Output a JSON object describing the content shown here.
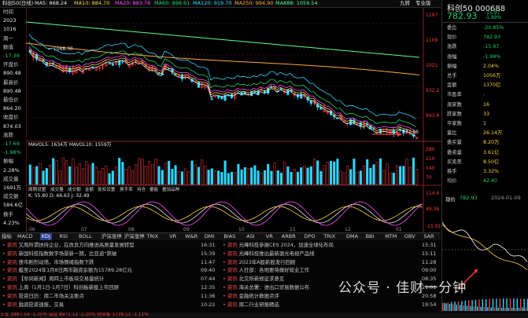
{
  "topbar": {
    "title": "科创50(日线)",
    "ma5": "MA5: 868.24",
    "ma10": "MA10: 884.70",
    "ma20": "MA20: 883.76",
    "ma60": "MA60: 898.61",
    "ma120": "MA120: 919.70",
    "ma250": "MA250: 994.90",
    "ma888": "MA888: 1059.54",
    "right_label": "九转",
    "right_label2": "专业版"
  },
  "left_info": {
    "labels": [
      "时间",
      "2023",
      "1016",
      "周一",
      "数值",
      "-17.36",
      "开盘价",
      "890.48",
      "最高价",
      "890.48",
      "最低价",
      "864.20",
      "收盘价",
      "874.03",
      "涨跌",
      "-17.69",
      "-1.98%",
      "振幅",
      "2.28%",
      "成交量",
      "1691万",
      "成交额",
      "584.6亿",
      "换手",
      "4.23%"
    ]
  },
  "chart": {
    "price_labels": [
      "1197",
      "1109",
      "1021",
      "932.2",
      "843.8",
      "777.56"
    ],
    "high_label": "1068.30",
    "low_label": "777.56",
    "vol_header": "MAVOL5: 1634万  MAVOL10: 1559万",
    "vol_labels": [
      "280",
      "210",
      "140",
      "70"
    ],
    "kdj_header": "K: 55.80  D: 66.63  J: 32.49",
    "kdj_labels": [
      "114.6",
      "49.36",
      "-15.91"
    ],
    "toolbar_items": [
      "周期设置",
      "成交量",
      "成交额",
      "金额",
      "复权设置",
      "换手率",
      "持仓",
      "量能",
      "叠加品种"
    ],
    "x_labels": [
      "06",
      "07",
      "08",
      "09",
      "10",
      "11",
      "12",
      "01"
    ]
  },
  "tabs": [
    "指标",
    "MACD",
    "KDJ",
    "RSI",
    "BOLL",
    "沪深涨停",
    "沪深涨停",
    "TRIX",
    "VR",
    "W&R",
    "DMI",
    "BIAS",
    "ASI",
    "VR",
    "ARBR",
    "DPO",
    "TRIX",
    "DMA",
    "BBI",
    "MTM",
    "OBV",
    "SAR",
    "EXPMA",
    "沪股通",
    "沪深上",
    "更多"
  ],
  "news": {
    "left": [
      {
        "src": "资讯",
        "title": "又周所谓扶持企业，在改良方向推进高质量发展转型",
        "time": "16:31"
      },
      {
        "src": "资讯",
        "title": "新国科技指数数字场景新一期，比亚迪“跌破",
        "time": "15:39"
      },
      {
        "src": "资讯",
        "title": "债市剧烈动荡，市场情绪指数下跌",
        "time": "11:47"
      },
      {
        "src": "资讯",
        "title": "截至2024年1月8日两市融资余额为15789.28亿元",
        "time": "09:40"
      },
      {
        "src": "资讯",
        "title": "【早间新闻】周四上市板块交易量统计",
        "time": "07:44"
      },
      {
        "src": "资讯",
        "title": "上周（1月1日-1月7日）科创板新股上市回顾",
        "time": "12:35"
      },
      {
        "src": "资讯",
        "title": "投资日历：周二市场关注要点",
        "time": "11:36"
      },
      {
        "src": "资讯",
        "title": "融资投资速报，交易",
        "time": "10:22"
      }
    ],
    "right": [
      {
        "src": "资讯",
        "title": "光峰科技参展CES 2024，加速全球化布局",
        "time": "15:31"
      },
      {
        "src": "资讯",
        "title": "光峰科技推出最新激光电视产品线",
        "time": "15:11"
      },
      {
        "src": "资讯",
        "title": "2023年A股新股发行回顾",
        "time": "11:28"
      },
      {
        "src": "资讯",
        "title": "人社部：各地要将做好就业工作",
        "time": "09:00"
      },
      {
        "src": "资讯",
        "title": "北交所新规征求意见",
        "time": "08:35"
      },
      {
        "src": "资讯",
        "title": "海关总署：进出口贸易数据公布",
        "time": "21:01"
      },
      {
        "src": "资讯",
        "title": "金融统计数据点评",
        "time": "20:58"
      },
      {
        "src": "资讯",
        "title": "周二行业研报精选",
        "time": "19:54"
      }
    ]
  },
  "status_bar": "上证 2887.54 -1.35% 深证 8971.12 -1.20% 创业板 1738.11 -1.11%",
  "right_panel": {
    "title": "科创50",
    "code": "000688",
    "price": "782.93",
    "change": "-15.97",
    "pct": "-1.99%",
    "rows": [
      {
        "k": "委比",
        "v": "-20.85%"
      },
      {
        "k": "现价",
        "v": "782.93"
      },
      {
        "k": "涨跌",
        "v": "-15.97"
      },
      {
        "k": "涨幅",
        "v": "-1.99%"
      },
      {
        "k": "振幅",
        "v": "2.04%"
      },
      {
        "k": "总手",
        "v": "1056万"
      },
      {
        "k": "金额",
        "v": "1370亿"
      },
      {
        "k": "市盈率",
        "v": "-"
      },
      {
        "k": "涨家数",
        "v": "16"
      },
      {
        "k": "跌家数",
        "v": "33"
      },
      {
        "k": "平家数",
        "v": "1"
      },
      {
        "k": "量比",
        "v": "26.14万"
      },
      {
        "k": "委买量",
        "v": "8.20万"
      },
      {
        "k": "委卖量",
        "v": "3.61亿"
      },
      {
        "k": "买卖差",
        "v": "8.50亿"
      },
      {
        "k": "换手",
        "v": "3.32%"
      },
      {
        "k": "均价",
        "v": "42.40"
      }
    ],
    "quote_label": "现价",
    "quote_price": "782.93",
    "quote_date": "2024-01-09"
  },
  "watermark": "公众号 · 佳财一分钟",
  "colors": {
    "up": "#ff3b3b",
    "down": "#19d36b",
    "bg": "#000000"
  }
}
